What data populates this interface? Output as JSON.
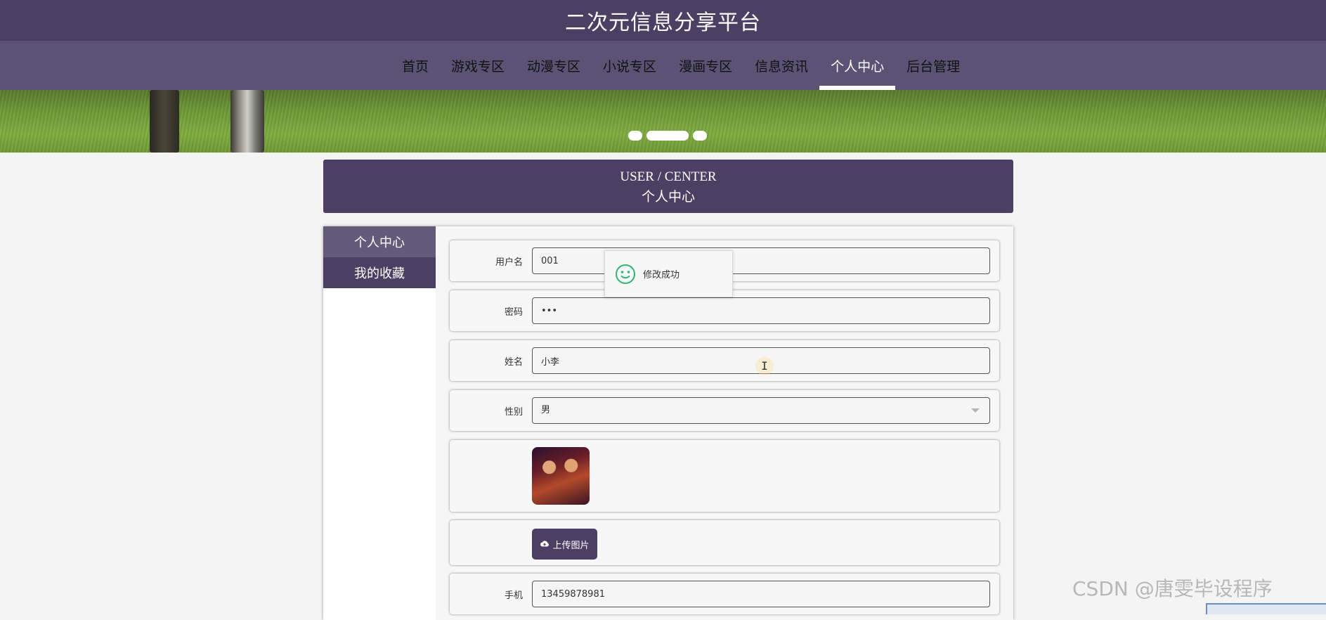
{
  "header": {
    "title": "二次元信息分享平台"
  },
  "nav": {
    "items": [
      "首页",
      "游戏专区",
      "动漫专区",
      "小说专区",
      "漫画专区",
      "信息资讯",
      "个人中心",
      "后台管理"
    ],
    "active_index": 6
  },
  "banner": {
    "slide_count": 3,
    "active_slide": 1
  },
  "section": {
    "en": "USER / CENTER",
    "cn": "个人中心"
  },
  "sidebar": {
    "items": [
      {
        "label": "个人中心"
      },
      {
        "label": "我的收藏"
      }
    ]
  },
  "form": {
    "username": {
      "label": "用户名",
      "value": "001"
    },
    "password": {
      "label": "密码",
      "value": "123"
    },
    "name": {
      "label": "姓名",
      "value": "小李"
    },
    "gender": {
      "label": "性别",
      "value": "男"
    },
    "upload": {
      "label": "上传图片"
    },
    "phone": {
      "label": "手机",
      "value": "13459878981"
    }
  },
  "toast": {
    "message": "修改成功",
    "icon": "smile-icon",
    "color": "#2bb673"
  },
  "watermark": {
    "text": "CSDN @唐雯毕设程序"
  },
  "colors": {
    "primary": "#4b4064",
    "nav": "#5b5375",
    "sidebar_active": "#635b79"
  }
}
